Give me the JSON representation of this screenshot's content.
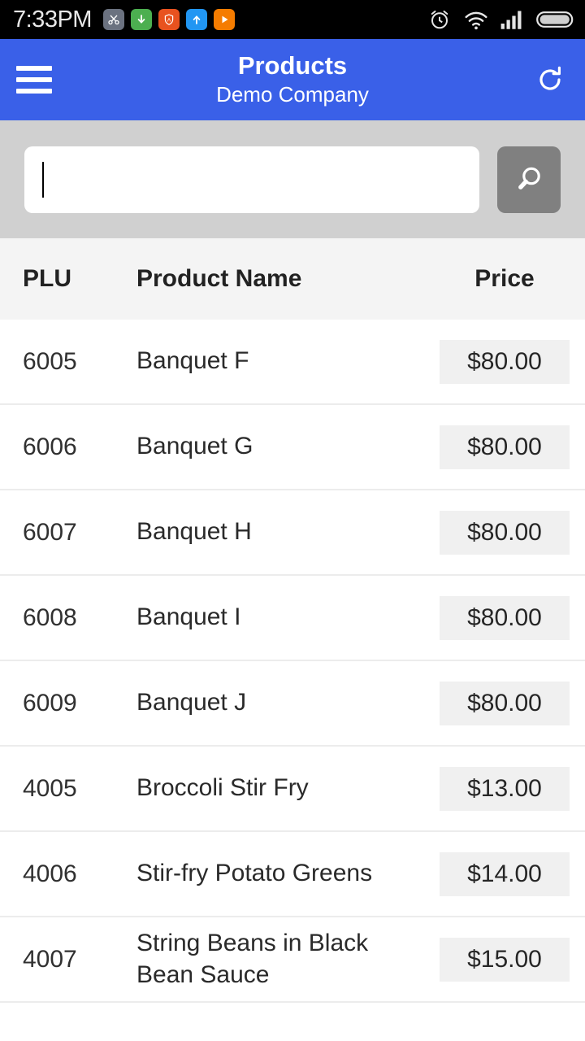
{
  "statusbar": {
    "time": "7:33PM",
    "app_icons": [
      {
        "name": "scissors-icon",
        "color": "#6b7280"
      },
      {
        "name": "download-arrow-icon",
        "color": "#4caf50"
      },
      {
        "name": "shield-a-icon",
        "color": "#e8521f"
      },
      {
        "name": "upload-arrow-icon",
        "color": "#2196f3"
      },
      {
        "name": "play-icon",
        "color": "#f57c00"
      }
    ],
    "system_icons": [
      "alarm-clock-icon",
      "wifi-icon",
      "signal-bars-icon",
      "battery-full-icon"
    ]
  },
  "appbar": {
    "menu_icon": "hamburger-menu-icon",
    "title": "Products",
    "subtitle": "Demo Company",
    "refresh_icon": "refresh-icon",
    "background_color": "#3a60e8"
  },
  "search": {
    "value": "",
    "placeholder": "",
    "button_icon": "search-icon",
    "button_color": "#808080",
    "bar_color": "#d0d0d0"
  },
  "table": {
    "columns": [
      "PLU",
      "Product Name",
      "Price"
    ],
    "rows": [
      {
        "plu": "6005",
        "name": "Banquet F",
        "price": "$80.00"
      },
      {
        "plu": "6006",
        "name": "Banquet G",
        "price": "$80.00"
      },
      {
        "plu": "6007",
        "name": "Banquet H",
        "price": "$80.00"
      },
      {
        "plu": "6008",
        "name": "Banquet I",
        "price": "$80.00"
      },
      {
        "plu": "6009",
        "name": "Banquet J",
        "price": "$80.00"
      },
      {
        "plu": "4005",
        "name": "Broccoli Stir Fry",
        "price": "$13.00"
      },
      {
        "plu": "4006",
        "name": "Stir-fry Potato Greens",
        "price": "$14.00"
      },
      {
        "plu": "4007",
        "name": "String Beans in Black Bean Sauce",
        "price": "$15.00"
      }
    ]
  }
}
